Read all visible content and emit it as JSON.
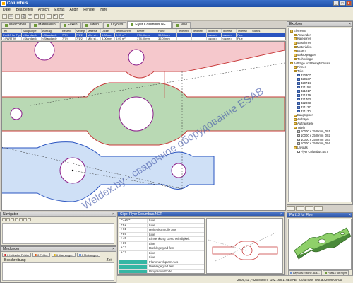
{
  "window": {
    "title": "Columbus"
  },
  "menu": [
    "Datei",
    "Bearbeiten",
    "Ansicht",
    "Extras",
    "Adgin",
    "Fenster",
    "Hilfe"
  ],
  "tabs": [
    "Maschinen",
    "Materialien",
    "Ecken",
    "Tafeln",
    "Layouts",
    "Flyer Columbus.NET",
    "Teile"
  ],
  "grid": {
    "headers": [
      "Teil",
      "Baugruppe",
      "Auftrag",
      "Bestellt",
      "Verlegt",
      "Material",
      "Dicke",
      "Teileflächen",
      "Breite",
      "Höhe",
      "Teiletext",
      "Teiletext",
      "Teiletext",
      "Teiletab",
      "Teiletab",
      "Status"
    ],
    "rows": [
      [
        "Part13 for Flyer",
        "<Standard>",
        "<Standard>",
        "7/7/4",
        "7/1/2",
        "Mild st...",
        "5.00mm",
        "0.37 m²",
        "374.00mm",
        "36.00mm",
        "",
        "",
        "<none>",
        "<none>",
        "Flue",
        ""
      ],
      [
        "1:PART 99",
        "<Standard>",
        "<Standard>",
        "7/7/4",
        "7/1/2",
        "Mild st...",
        "5.00mm",
        "0.07 m²",
        "374.00mm",
        "36.00mm",
        "",
        "",
        "<none>",
        "<none>",
        "Flue",
        ""
      ]
    ]
  },
  "navigator": {
    "title": "Navigator"
  },
  "messages": {
    "title": "Meldungen",
    "filters": [
      "0 Kritische Fehler",
      "0 Fehler",
      "0 Warnungen",
      "0 Meldungen"
    ],
    "column": "Beschreibung",
    "column_right": "Zeit"
  },
  "code_panel": {
    "title": "Cign: Flyer Columbus.NET",
    "rows": [
      {
        "k": "~116~",
        "v": "Line"
      },
      {
        "k": "+61",
        "v": "Line"
      },
      {
        "k": "+61",
        "v": "Höhenkontrolle Aus"
      },
      {
        "k": "+89",
        "v": "Line"
      },
      {
        "k": "+45",
        "v": "Einsenkung Geschwindigkeit"
      },
      {
        "k": "+89",
        "v": "Line"
      },
      {
        "k": "+13",
        "v": "Drehlegegrad fest"
      },
      {
        "k": "+17",
        "v": "Line"
      },
      {
        "k": "",
        "v": "Line"
      },
      {
        "k": "",
        "v": "Flammdrehplam Aus"
      },
      {
        "k": "",
        "v": "Drehlegegrad fest"
      },
      {
        "k": "",
        "v": "Programm Ende"
      }
    ],
    "highlight_rows": [
      9,
      10,
      11
    ]
  },
  "explorer": {
    "title": "Explorer",
    "nodes": [
      {
        "label": "Elemente",
        "lvl": 0,
        "icon": "folder"
      },
      {
        "label": "Anwender",
        "lvl": 1,
        "icon": "folder"
      },
      {
        "label": "Kategorien",
        "lvl": 1,
        "icon": "folder"
      },
      {
        "label": "Maschinen",
        "lvl": 1,
        "icon": "folder"
      },
      {
        "label": "Materialien",
        "lvl": 1,
        "icon": "folder"
      },
      {
        "label": "Ecken",
        "lvl": 1,
        "icon": "folder"
      },
      {
        "label": "Makrogruppen",
        "lvl": 1,
        "icon": "folder"
      },
      {
        "label": "Technologie",
        "lvl": 1,
        "icon": "folder"
      },
      {
        "label": "Aufträge und Fertigfabrikate",
        "lvl": 0,
        "icon": "folder"
      },
      {
        "label": "Firmen",
        "lvl": 1,
        "icon": "folder"
      },
      {
        "label": "Teile",
        "lvl": 1,
        "icon": "folder"
      },
      {
        "label": "320307",
        "lvl": 2,
        "icon": "part"
      },
      {
        "label": "320537",
        "lvl": 2,
        "icon": "part"
      },
      {
        "label": "320714",
        "lvl": 2,
        "icon": "part"
      },
      {
        "label": "321158",
        "lvl": 2,
        "icon": "part"
      },
      {
        "label": "321217",
        "lvl": 2,
        "icon": "part"
      },
      {
        "label": "321219",
        "lvl": 2,
        "icon": "part"
      },
      {
        "label": "321763",
        "lvl": 2,
        "icon": "part"
      },
      {
        "label": "322063",
        "lvl": 2,
        "icon": "part"
      },
      {
        "label": "321127",
        "lvl": 2,
        "icon": "part"
      },
      {
        "label": "321130",
        "lvl": 2,
        "icon": "part"
      },
      {
        "label": "Baugruppen",
        "lvl": 1,
        "icon": "folder"
      },
      {
        "label": "Aufträge",
        "lvl": 1,
        "icon": "folder"
      },
      {
        "label": "Auftragsteile",
        "lvl": 1,
        "icon": "folder"
      },
      {
        "label": "Tafeln",
        "lvl": 1,
        "icon": "folder"
      },
      {
        "label": "10000 x 2500mm_001",
        "lvl": 2,
        "icon": "sheet"
      },
      {
        "label": "10000 x 2500mm_002",
        "lvl": 2,
        "icon": "sheet"
      },
      {
        "label": "10000 x 2500mm_003",
        "lvl": 2,
        "icon": "sheet"
      },
      {
        "label": "10000 x 2500mm_004",
        "lvl": 2,
        "icon": "sheet"
      },
      {
        "label": "Layouts",
        "lvl": 1,
        "icon": "folder"
      },
      {
        "label": "Flyer Columbus.NET",
        "lvl": 2,
        "icon": "doc"
      }
    ]
  },
  "part_view": {
    "title": "Part13 for Flyer",
    "bottom_tabs": [
      "Layouts: Stone Aus...",
      "Part13 for Flyer"
    ]
  },
  "status": {
    "coords": "2805,41 ; -526,80mm",
    "host": "192.168.1.7\\ESAB",
    "db": "Columbus Test ab 2008-09-05"
  },
  "watermark": "Weldex.by - сварочное оборудование ESAB",
  "colors": {
    "accent": "#2a54c0",
    "part_fill": "#b9d9b4",
    "part_red_fill": "#f5c8cc",
    "part_blue_fill": "#cfe0f6",
    "hole_stroke": "#8a1d8a"
  }
}
